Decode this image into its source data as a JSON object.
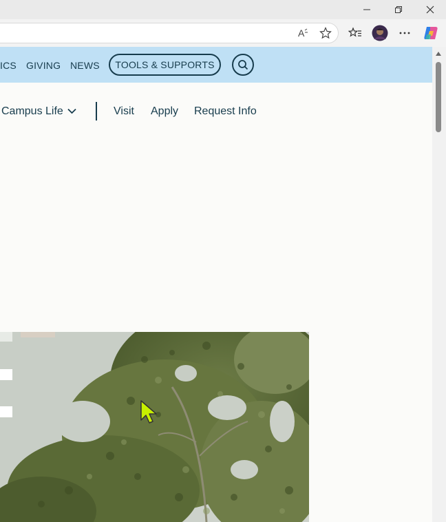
{
  "browser": {
    "read_aloud_icon": "read-aloud-icon",
    "favorite_icon": "star-icon"
  },
  "utility_nav": {
    "items": [
      "ICS",
      "GIVING",
      "NEWS"
    ],
    "tools_label": "TOOLS & SUPPORTS"
  },
  "main_nav": {
    "campus_life": "Campus Life",
    "visit": "Visit",
    "apply": "Apply",
    "request_info": "Request Info"
  },
  "colors": {
    "utility_bg": "#bfe0f5",
    "navy": "#173c4d",
    "page_bg": "#fbfbf9",
    "cursor": "#c8f000"
  }
}
